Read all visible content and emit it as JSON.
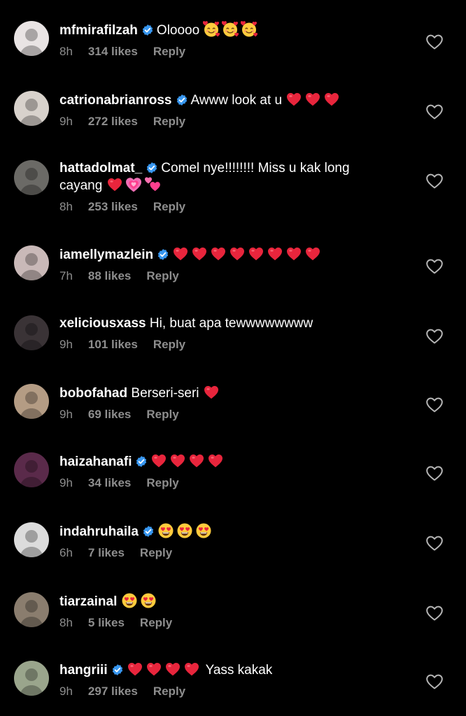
{
  "colors": {
    "background": "#000000",
    "text": "#ffffff",
    "secondary_text": "#8e8e8e",
    "verified_badge": "#3897f0",
    "heart_emoji": "#e8253c"
  },
  "comments": [
    {
      "username": "mfmirafilzah",
      "verified": true,
      "text_before": "Oloooo",
      "emojis": [
        "smiling-face-with-hearts",
        "smiling-face-with-hearts",
        "smiling-face-with-hearts"
      ],
      "text_after": "",
      "time": "8h",
      "likes": "314 likes",
      "reply": "Reply",
      "avatar_color": "#e9e4e4"
    },
    {
      "username": "catrionabrianross",
      "verified": true,
      "text_before": "Awww look at u",
      "emojis": [
        "red-heart",
        "red-heart",
        "red-heart"
      ],
      "text_after": "",
      "time": "9h",
      "likes": "272 likes",
      "reply": "Reply",
      "avatar_color": "#d8d2cc"
    },
    {
      "username": "hattadolmat_",
      "verified": true,
      "text_before": "Comel nye!!!!!!!! Miss u kak long cayang",
      "emojis": [
        "red-heart",
        "growing-heart",
        "two-hearts"
      ],
      "text_after": "",
      "time": "8h",
      "likes": "253 likes",
      "reply": "Reply",
      "avatar_color": "#6b6a66"
    },
    {
      "username": "iamellymazlein",
      "verified": true,
      "text_before": "",
      "emojis": [
        "red-heart",
        "red-heart",
        "red-heart",
        "red-heart",
        "red-heart",
        "red-heart",
        "red-heart",
        "red-heart"
      ],
      "text_after": "",
      "time": "7h",
      "likes": "88 likes",
      "reply": "Reply",
      "avatar_color": "#c9b9b8"
    },
    {
      "username": "xeliciousxass",
      "verified": false,
      "text_before": "Hi, buat apa tewwwwwwww",
      "emojis": [],
      "text_after": "",
      "time": "9h",
      "likes": "101 likes",
      "reply": "Reply",
      "avatar_color": "#3a3336"
    },
    {
      "username": "bobofahad",
      "verified": false,
      "text_before": "Berseri-seri",
      "emojis": [
        "red-heart"
      ],
      "text_after": "",
      "time": "9h",
      "likes": "69 likes",
      "reply": "Reply",
      "avatar_color": "#b49c84"
    },
    {
      "username": "haizahanafi",
      "verified": true,
      "text_before": "",
      "emojis": [
        "red-heart",
        "red-heart",
        "red-heart",
        "red-heart"
      ],
      "text_after": "",
      "time": "9h",
      "likes": "34 likes",
      "reply": "Reply",
      "avatar_color": "#5a2a4a"
    },
    {
      "username": "indahruhaila",
      "verified": true,
      "text_before": "",
      "emojis": [
        "heart-eyes",
        "heart-eyes",
        "heart-eyes"
      ],
      "text_after": "",
      "time": "6h",
      "likes": "7 likes",
      "reply": "Reply",
      "avatar_color": "#dcdcdc"
    },
    {
      "username": "tiarzainal",
      "verified": false,
      "text_before": "",
      "emojis": [
        "heart-eyes",
        "heart-eyes"
      ],
      "text_after": "",
      "time": "8h",
      "likes": "5 likes",
      "reply": "Reply",
      "avatar_color": "#8a7d6e"
    },
    {
      "username": "hangriii",
      "verified": true,
      "text_before": "",
      "emojis": [
        "red-heart",
        "red-heart",
        "red-heart",
        "red-heart"
      ],
      "text_after": "Yass kakak",
      "time": "9h",
      "likes": "297 likes",
      "reply": "Reply",
      "avatar_color": "#9aa58c"
    }
  ]
}
